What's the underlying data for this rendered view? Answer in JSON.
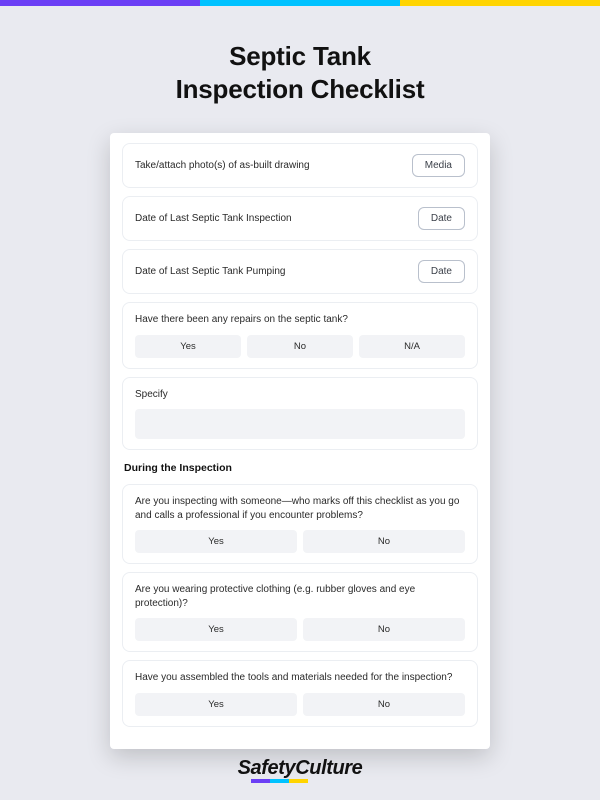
{
  "title_line1": "Septic Tank",
  "title_line2": "Inspection Checklist",
  "items": [
    {
      "label": "Take/attach photo(s) of as-built drawing",
      "button": "Media"
    },
    {
      "label": "Date of Last Septic Tank Inspection",
      "button": "Date"
    },
    {
      "label": "Date of Last Septic Tank Pumping",
      "button": "Date"
    }
  ],
  "repairs_question": {
    "label": "Have there been any repairs on the septic tank?",
    "options": [
      "Yes",
      "No",
      "N/A"
    ]
  },
  "specify": {
    "label": "Specify"
  },
  "section_header": "During the Inspection",
  "inspection_questions": [
    {
      "label": "Are you inspecting with someone—who marks off this checklist as you go and calls a professional if you encounter problems?",
      "options": [
        "Yes",
        "No"
      ]
    },
    {
      "label": "Are you wearing protective clothing (e.g. rubber gloves and eye protection)?",
      "options": [
        "Yes",
        "No"
      ]
    },
    {
      "label": "Have you assembled the tools and materials needed for the inspection?",
      "options": [
        "Yes",
        "No"
      ]
    }
  ],
  "brand": "SafetyCulture"
}
